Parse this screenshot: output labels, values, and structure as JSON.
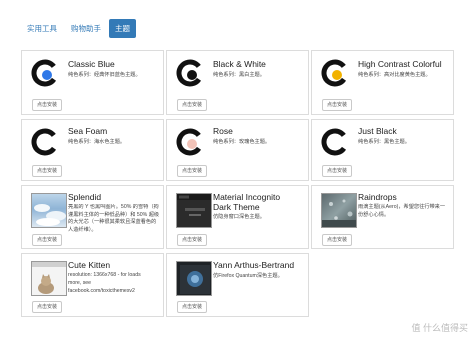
{
  "tabs": [
    "实用工具",
    "购物助手",
    "主题"
  ],
  "themes": [
    {
      "title": "Classic Blue",
      "desc": "纯色系列：经典怀旧蓝色主题。",
      "button": "点击安装",
      "dot": "#2f78e8"
    },
    {
      "title": "Black & White",
      "desc": "纯色系列：黑白主题。",
      "button": "点击安装",
      "dot": "#111111"
    },
    {
      "title": "High Contrast Colorful",
      "desc": "纯色系列：高对比度黄色主题。",
      "button": "点击安装",
      "dot": "#f2b200"
    },
    {
      "title": "Sea Foam",
      "desc": "纯色系列：海水色主题。",
      "button": "点击安装",
      "dot": "#ffffff"
    },
    {
      "title": "Rose",
      "desc": "纯色系列：玫瑰色主题。",
      "button": "点击安装",
      "dot": "#f2c3b8"
    },
    {
      "title": "Just Black",
      "desc": "纯色系列：黑色主题。",
      "button": "点击安装",
      "dot": "#ffffff"
    },
    {
      "title": "Splendid",
      "desc": "亮黑的 Y 也黑叫图片。50% 的雪特（拘谨黑料主体的一种低品种）和 50% 超级的大光芯（一种很其柔软且深蓝看色的人造纤维）。",
      "button": "点击安装"
    },
    {
      "title_lines": [
        "Material Incognito",
        "Dark Theme"
      ],
      "desc": "仿隐身窗口深色主题。",
      "button": "点击安装"
    },
    {
      "title": "Raindrops",
      "desc": "雨滴主题(从Aero)，希望您往行带来一份舒心心情。",
      "button": "点击安装"
    },
    {
      "title": "Cute Kitten",
      "desc_lines": [
        "resolution: 1366x768 - for loads",
        "more, see",
        "facebook.com/toxicthemesv2"
      ],
      "button": "点击安装"
    },
    {
      "title": "Yann Arthus-Bertrand",
      "desc": "仿Firefox Quantum深色主题。",
      "button": "点击安装"
    }
  ],
  "watermark": "值 什么值得买"
}
